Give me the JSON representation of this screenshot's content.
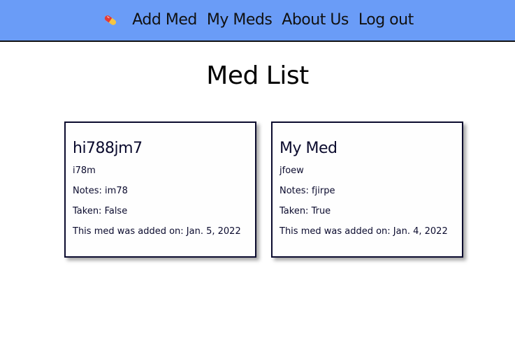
{
  "nav": {
    "logo_icon": "pill-icon",
    "links": [
      {
        "label": "Add Med"
      },
      {
        "label": "My Meds"
      },
      {
        "label": "About Us"
      },
      {
        "label": "Log out"
      }
    ]
  },
  "page": {
    "title": "Med List"
  },
  "meds": [
    {
      "name": "hi788jm7",
      "description": "i78m",
      "notes": "Notes: im78",
      "taken": "Taken: False",
      "added": "This med was added on: Jan. 5, 2022"
    },
    {
      "name": "My Med",
      "description": "jfoew",
      "notes": "Notes: fjirpe",
      "taken": "Taken: True",
      "added": "This med was added on: Jan. 4, 2022"
    }
  ],
  "colors": {
    "navbar_bg": "#6a9cf7",
    "card_border": "#0b0b2e",
    "page_bg": "#ffffff"
  }
}
